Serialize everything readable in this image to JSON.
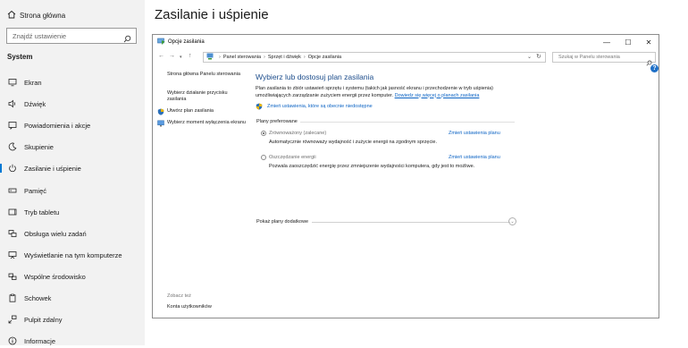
{
  "settings": {
    "home_label": "Strona główna",
    "search_placeholder": "Znajdź ustawienie",
    "section_label": "System",
    "page_title": "Zasilanie i uśpienie",
    "nav_items": [
      {
        "label": "Ekran",
        "icon": "monitor-icon"
      },
      {
        "label": "Dźwięk",
        "icon": "speaker-icon"
      },
      {
        "label": "Powiadomienia i akcje",
        "icon": "notification-icon"
      },
      {
        "label": "Skupienie",
        "icon": "moon-icon"
      },
      {
        "label": "Zasilanie i uśpienie",
        "icon": "power-icon",
        "active": true
      },
      {
        "label": "Pamięć",
        "icon": "storage-icon"
      },
      {
        "label": "Tryb tabletu",
        "icon": "tablet-icon"
      },
      {
        "label": "Obsługa wielu zadań",
        "icon": "multitask-icon"
      },
      {
        "label": "Wyświetlanie na tym komputerze",
        "icon": "project-icon"
      },
      {
        "label": "Wspólne środowisko",
        "icon": "shared-icon"
      },
      {
        "label": "Schowek",
        "icon": "clipboard-icon"
      },
      {
        "label": "Pulpit zdalny",
        "icon": "remote-desktop-icon"
      },
      {
        "label": "Informacje",
        "icon": "info-icon"
      }
    ]
  },
  "window": {
    "title": "Opcje zasilania",
    "breadcrumb": [
      "Panel sterowania",
      "Sprzęt i dźwięk",
      "Opcje zasilania"
    ],
    "search_placeholder": "Szukaj w Panelu sterowania",
    "left_links": [
      {
        "label": "Strona główna Panelu sterowania"
      },
      {
        "label": "Wybierz działanie przycisku zasilania"
      },
      {
        "label": "Utwórz plan zasilania",
        "icon": "power-plan-icon"
      },
      {
        "label": "Wybierz moment wyłączenia ekranu",
        "icon": "display-timer-icon"
      }
    ],
    "see_also": "Zobacz też",
    "see_also_link": "Konta użytkowników",
    "heading": "Wybierz lub dostosuj plan zasilania",
    "description": "Plan zasilania to zbiór ustawień sprzętu i systemu (takich jak jasność ekranu i przechodzenie w tryb uśpienia) umożliwiających zarządzanie zużyciem energii przez komputer.",
    "description_link": "Dowiedz się więcej o planach zasilania",
    "change_link": "Zmień ustawienia, które są obecnie niedostępne",
    "group_label": "Plany preferowane",
    "plans": [
      {
        "name": "Zrównoważony (zalecane)",
        "change": "Zmień ustawienia planu",
        "desc": "Automatycznie równoważy wydajność i zużycie energii na zgodnym sprzęcie.",
        "selected": true
      },
      {
        "name": "Oszczędzanie energii",
        "change": "Zmień ustawienia planu",
        "desc": "Pozwala zaoszczędzić energię przez zmniejszenie wydajności komputera, gdy jest to możliwe.",
        "selected": false
      }
    ],
    "more_plans": "Pokaż plany dodatkowe"
  },
  "colors": {
    "accent": "#0078d4",
    "link": "#0b63c4",
    "heading": "#1e4e8c"
  }
}
